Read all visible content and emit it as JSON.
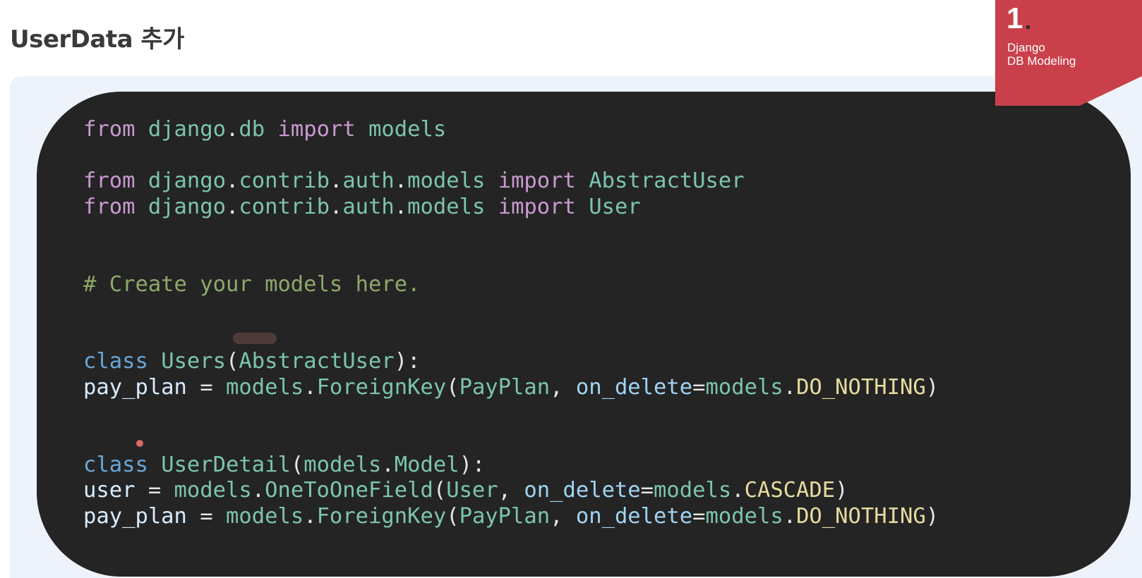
{
  "slide": {
    "title": "UserData 추가"
  },
  "badge": {
    "number": "1",
    "dot": ".",
    "line1": "Django",
    "line2": "DB Modeling",
    "color": "#c9404a"
  },
  "code": {
    "language": "python",
    "lines": [
      [
        {
          "t": "from",
          "c": "kw"
        },
        {
          "t": " ",
          "c": "punc"
        },
        {
          "t": "django",
          "c": "mod"
        },
        {
          "t": ".",
          "c": "punc"
        },
        {
          "t": "db",
          "c": "mod"
        },
        {
          "t": " ",
          "c": "punc"
        },
        {
          "t": "import",
          "c": "kw"
        },
        {
          "t": " ",
          "c": "punc"
        },
        {
          "t": "models",
          "c": "mod"
        }
      ],
      [],
      [
        {
          "t": "from",
          "c": "kw"
        },
        {
          "t": " ",
          "c": "punc"
        },
        {
          "t": "django",
          "c": "mod"
        },
        {
          "t": ".",
          "c": "punc"
        },
        {
          "t": "contrib",
          "c": "mod"
        },
        {
          "t": ".",
          "c": "punc"
        },
        {
          "t": "auth",
          "c": "mod"
        },
        {
          "t": ".",
          "c": "punc"
        },
        {
          "t": "models",
          "c": "mod"
        },
        {
          "t": " ",
          "c": "punc"
        },
        {
          "t": "import",
          "c": "kw"
        },
        {
          "t": " ",
          "c": "punc"
        },
        {
          "t": "AbstractUser",
          "c": "cls"
        }
      ],
      [
        {
          "t": "from",
          "c": "kw"
        },
        {
          "t": " ",
          "c": "punc"
        },
        {
          "t": "django",
          "c": "mod"
        },
        {
          "t": ".",
          "c": "punc"
        },
        {
          "t": "contrib",
          "c": "mod"
        },
        {
          "t": ".",
          "c": "punc"
        },
        {
          "t": "auth",
          "c": "mod"
        },
        {
          "t": ".",
          "c": "punc"
        },
        {
          "t": "models",
          "c": "mod"
        },
        {
          "t": " ",
          "c": "punc"
        },
        {
          "t": "import",
          "c": "kw"
        },
        {
          "t": " ",
          "c": "punc"
        },
        {
          "t": "User",
          "c": "cls"
        }
      ],
      [],
      [],
      [
        {
          "t": "# Create your models here.",
          "c": "comment"
        }
      ],
      [],
      [],
      [
        {
          "t": "class",
          "c": "def"
        },
        {
          "t": " ",
          "c": "punc"
        },
        {
          "t": "Users",
          "c": "cls"
        },
        {
          "t": "(",
          "c": "punc"
        },
        {
          "t": "AbstractUser",
          "c": "cls"
        },
        {
          "t": "):",
          "c": "punc"
        }
      ],
      [
        {
          "t": "pay_plan",
          "c": "var"
        },
        {
          "t": " = ",
          "c": "punc"
        },
        {
          "t": "models",
          "c": "mod"
        },
        {
          "t": ".",
          "c": "punc"
        },
        {
          "t": "ForeignKey",
          "c": "cls"
        },
        {
          "t": "(",
          "c": "punc"
        },
        {
          "t": "PayPlan",
          "c": "cls"
        },
        {
          "t": ", ",
          "c": "punc"
        },
        {
          "t": "on_delete",
          "c": "attr"
        },
        {
          "t": "=",
          "c": "punc"
        },
        {
          "t": "models",
          "c": "mod"
        },
        {
          "t": ".",
          "c": "punc"
        },
        {
          "t": "DO_NOTHING",
          "c": "const"
        },
        {
          "t": ")",
          "c": "punc"
        }
      ],
      [],
      [],
      [
        {
          "t": "class",
          "c": "def"
        },
        {
          "t": " ",
          "c": "punc"
        },
        {
          "t": "UserDetail",
          "c": "cls"
        },
        {
          "t": "(",
          "c": "punc"
        },
        {
          "t": "models",
          "c": "mod"
        },
        {
          "t": ".",
          "c": "punc"
        },
        {
          "t": "Model",
          "c": "cls"
        },
        {
          "t": "):",
          "c": "punc"
        }
      ],
      [
        {
          "t": "user",
          "c": "var"
        },
        {
          "t": " = ",
          "c": "punc"
        },
        {
          "t": "models",
          "c": "mod"
        },
        {
          "t": ".",
          "c": "punc"
        },
        {
          "t": "OneToOneField",
          "c": "cls"
        },
        {
          "t": "(",
          "c": "punc"
        },
        {
          "t": "User",
          "c": "cls"
        },
        {
          "t": ", ",
          "c": "punc"
        },
        {
          "t": "on_delete",
          "c": "attr"
        },
        {
          "t": "=",
          "c": "punc"
        },
        {
          "t": "models",
          "c": "mod"
        },
        {
          "t": ".",
          "c": "punc"
        },
        {
          "t": "CASCADE",
          "c": "const"
        },
        {
          "t": ")",
          "c": "punc"
        }
      ],
      [
        {
          "t": "pay_plan",
          "c": "var"
        },
        {
          "t": " = ",
          "c": "punc"
        },
        {
          "t": "models",
          "c": "mod"
        },
        {
          "t": ".",
          "c": "punc"
        },
        {
          "t": "ForeignKey",
          "c": "cls"
        },
        {
          "t": "(",
          "c": "punc"
        },
        {
          "t": "PayPlan",
          "c": "cls"
        },
        {
          "t": ", ",
          "c": "punc"
        },
        {
          "t": "on_delete",
          "c": "attr"
        },
        {
          "t": "=",
          "c": "punc"
        },
        {
          "t": "models",
          "c": "mod"
        },
        {
          "t": ".",
          "c": "punc"
        },
        {
          "t": "DO_NOTHING",
          "c": "const"
        },
        {
          "t": ")",
          "c": "punc"
        }
      ]
    ]
  }
}
